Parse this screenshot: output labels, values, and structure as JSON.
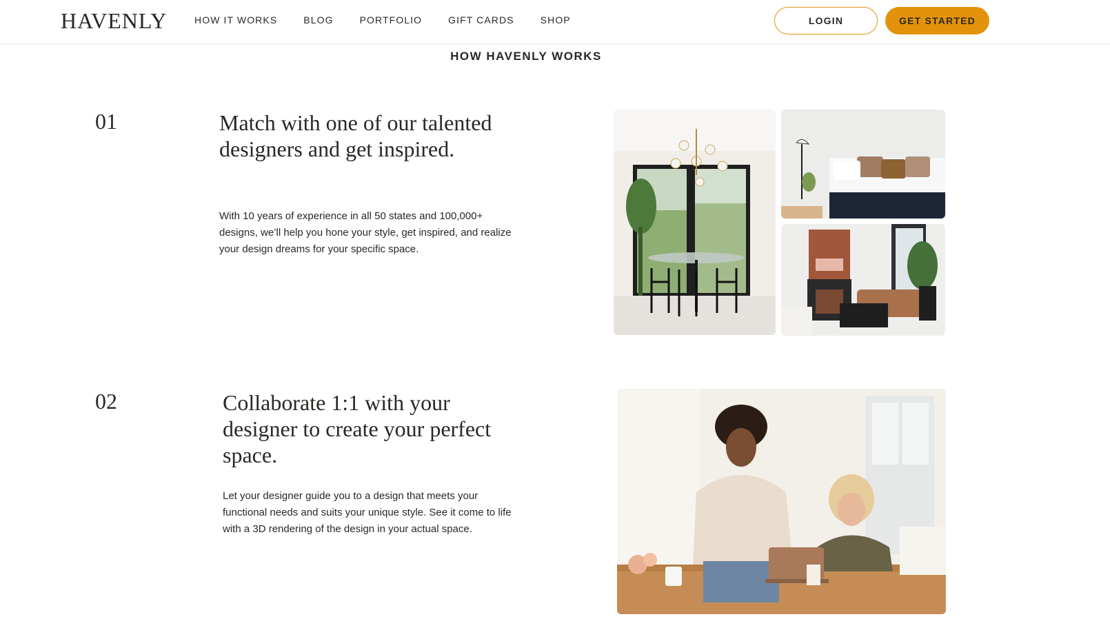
{
  "header": {
    "logo": "HAVENLY",
    "nav": [
      "HOW IT WORKS",
      "BLOG",
      "PORTFOLIO",
      "GIFT CARDS",
      "SHOP"
    ],
    "login": "LOGIN",
    "get_started": "GET STARTED"
  },
  "section_title": "HOW HAVENLY WORKS",
  "steps": [
    {
      "number": "01",
      "heading": "Match with one of our talented designers and get inspired.",
      "body": "With 10 years of experience in all 50 states and 100,000+ designs, we’ll help you hone your style, get inspired, and realize your design dreams for your specific space."
    },
    {
      "number": "02",
      "heading": "Collaborate 1:1 with your designer to create your perfect space.",
      "body": "Let your designer guide you to a design that meets your functional needs and suits your unique style. See it come to life with a 3D rendering of the design in your actual space."
    }
  ],
  "colors": {
    "accent": "#e3930b",
    "text": "#2b2724"
  }
}
